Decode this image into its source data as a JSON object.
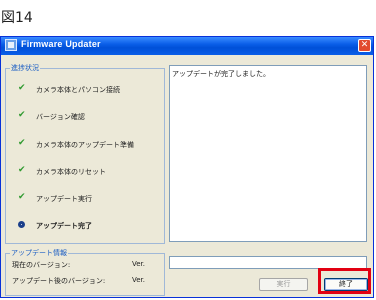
{
  "figure_label": "図14",
  "window": {
    "title": "Firmware Updater",
    "app_icon": "firmware-updater-icon",
    "close_icon": "close-icon",
    "close_symbol": "✕"
  },
  "progress": {
    "group_title": "進捗状況",
    "steps": [
      {
        "label": "カメラ本体とパソコン接続",
        "status": "done",
        "icon": "check-icon"
      },
      {
        "label": "バージョン確認",
        "status": "done",
        "icon": "check-icon"
      },
      {
        "label": "カメラ本体のアップデート準備",
        "status": "done",
        "icon": "check-icon"
      },
      {
        "label": "カメラ本体のリセット",
        "status": "done",
        "icon": "check-icon"
      },
      {
        "label": "アップデート実行",
        "status": "done",
        "icon": "check-icon"
      },
      {
        "label": "アップデート完了",
        "status": "current",
        "icon": "current-step-icon"
      }
    ]
  },
  "message": "アップデートが完了しました。",
  "update_info": {
    "group_title": "アップデート情報",
    "current_version_label": "現在のバージョン:",
    "current_version_value": "Ver.",
    "after_version_label": "アップデート後のバージョン:",
    "after_version_value": "Ver."
  },
  "buttons": {
    "run_label": "実行",
    "end_label": "終了"
  },
  "colors": {
    "title_bar": "#0a5ee8",
    "check": "#2f9a2f",
    "group_title": "#1c5ec4",
    "highlight": "#e20012"
  }
}
